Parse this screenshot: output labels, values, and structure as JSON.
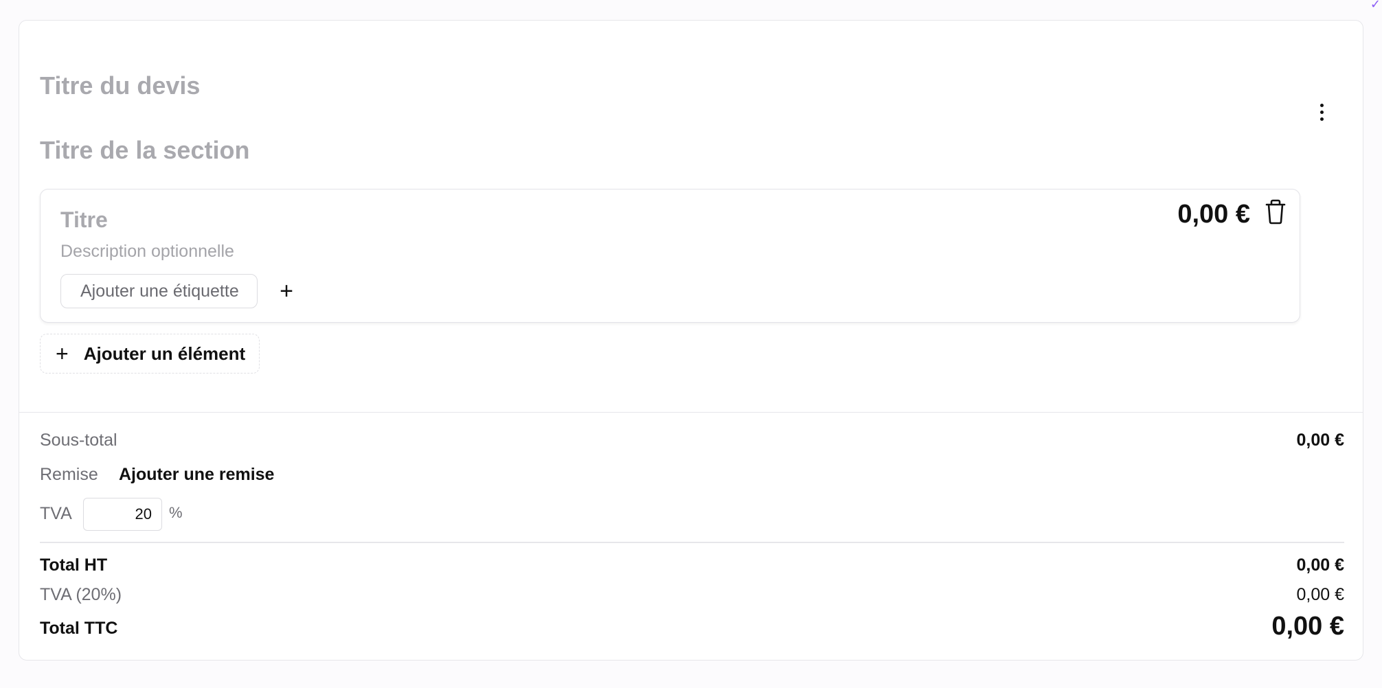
{
  "header": {
    "quote_title_placeholder": "Titre du devis",
    "more_icon": "more-vertical-icon"
  },
  "section": {
    "title_placeholder": "Titre de la section"
  },
  "item": {
    "title_placeholder": "Titre",
    "description_placeholder": "Description optionnelle",
    "tag_placeholder": "Ajouter une étiquette",
    "tag_add_label": "+",
    "price": "0,00 €",
    "delete_icon": "trash-icon"
  },
  "add_element": {
    "icon": "+",
    "label": "Ajouter un élément"
  },
  "summary": {
    "subtotal_label": "Sous-total",
    "subtotal_value": "0,00 €",
    "discount_label": "Remise",
    "discount_action": "Ajouter une remise",
    "tva_label": "TVA",
    "tva_rate": "20",
    "tva_unit": "%",
    "total_ht_label": "Total HT",
    "total_ht_value": "0,00 €",
    "tva_amount_label": "TVA (20%)",
    "tva_amount_value": "0,00 €",
    "total_ttc_label": "Total TTC",
    "total_ttc_value": "0,00 €"
  },
  "colors": {
    "placeholder_gray": "#a9a9ae",
    "border": "#e6e6ea",
    "accent": "#8b5cf6"
  }
}
